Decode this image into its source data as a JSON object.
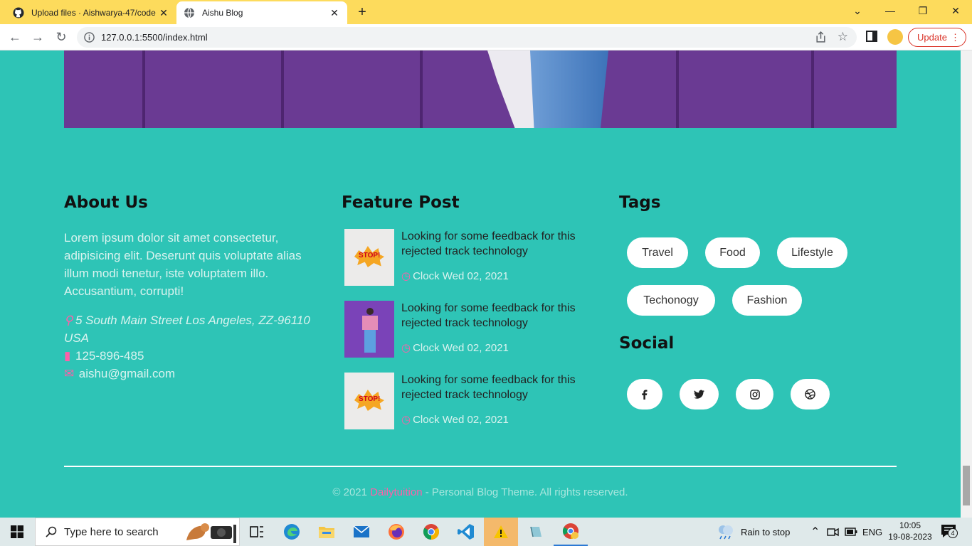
{
  "browser": {
    "tabs": [
      {
        "title": "Upload files · Aishwarya-47/code",
        "favicon": "github-icon",
        "active": false
      },
      {
        "title": "Aishu Blog",
        "favicon": "globe-icon",
        "active": true
      }
    ],
    "url": "127.0.0.1:5500/index.html",
    "update_label": "Update",
    "accent": "#fddb5c"
  },
  "about": {
    "title": "About Us",
    "text": "Lorem ipsum dolor sit amet consectetur, adipisicing elit. Deserunt quis voluptate alias illum modi tenetur, iste voluptatem illo. Accusantium, corrupti!",
    "address": "5 South Main Street Los Angeles, ZZ-96110 USA",
    "phone": "125-896-485",
    "email": "aishu@gmail.com"
  },
  "feature": {
    "title": "Feature Post",
    "posts": [
      {
        "title": "Looking for some feedback for this rejected track technology",
        "date": "Clock Wed 02, 2021",
        "image": "stop-sticker"
      },
      {
        "title": "Looking for some feedback for this rejected track technology",
        "date": "Clock Wed 02, 2021",
        "image": "person-purple-wall"
      },
      {
        "title": "Looking for some feedback for this rejected track technology",
        "date": "Clock Wed 02, 2021",
        "image": "stop-sticker"
      }
    ]
  },
  "tags": {
    "title": "Tags",
    "items": [
      "Travel",
      "Food",
      "Lifestyle",
      "Techonogy",
      "Fashion"
    ]
  },
  "social": {
    "title": "Social",
    "icons": [
      "facebook-icon",
      "twitter-icon",
      "instagram-icon",
      "dribbble-icon"
    ]
  },
  "footer": {
    "prefix": "© 2021 ",
    "brand": "Dailytuition",
    "suffix": " - Personal Blog Theme. All rights reserved."
  },
  "taskbar": {
    "search_placeholder": "Type here to search",
    "weather": "Rain to stop",
    "lang": "ENG",
    "time": "10:05",
    "date": "19-08-2023",
    "notifications": "4"
  },
  "colors": {
    "page_bg": "#2ec4b6",
    "accent_pink": "#ff5fa8"
  }
}
